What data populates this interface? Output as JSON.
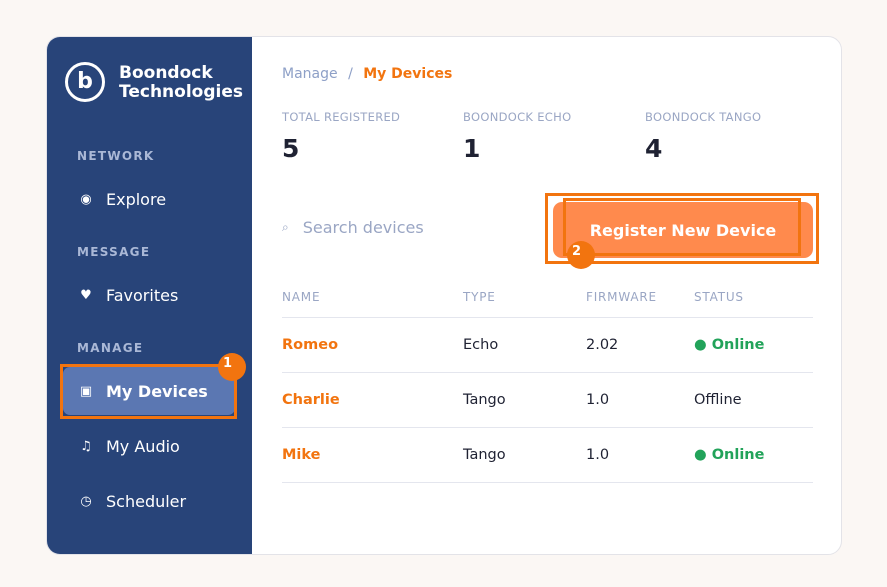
{
  "brand": {
    "logo_letter": "b",
    "name_line1": "Boondock",
    "name_line2": "Technologies"
  },
  "sidebar": {
    "sections": [
      {
        "label": "NETWORK"
      },
      {
        "label": "MESSAGE"
      },
      {
        "label": "MANAGE"
      }
    ],
    "items": [
      {
        "label": "Explore",
        "icon": "radio-icon",
        "glyph": "◉"
      },
      {
        "label": "Favorites",
        "icon": "heart-icon",
        "glyph": "♥"
      },
      {
        "label": "My Devices",
        "icon": "device-icon",
        "glyph": "▣",
        "active": true
      },
      {
        "label": "My Audio",
        "icon": "music-note-icon",
        "glyph": "♫"
      },
      {
        "label": "Scheduler",
        "icon": "clock-icon",
        "glyph": "◷"
      }
    ]
  },
  "breadcrumb": {
    "parent": "Manage",
    "separator": "/",
    "current": "My Devices"
  },
  "stats": [
    {
      "label": "TOTAL REGISTERED",
      "value": "5"
    },
    {
      "label": "BOONDOCK ECHO",
      "value": "1"
    },
    {
      "label": "BOONDOCK TANGO",
      "value": "4"
    }
  ],
  "search": {
    "placeholder": "Search devices",
    "icon_glyph": "⌕"
  },
  "register_button": {
    "label": "Register New Device"
  },
  "table": {
    "columns": [
      "NAME",
      "TYPE",
      "FIRMWARE",
      "STATUS"
    ],
    "rows": [
      {
        "name": "Romeo",
        "type": "Echo",
        "firmware": "2.02",
        "status": "● Online"
      },
      {
        "name": "Charlie",
        "type": "Tango",
        "firmware": "1.0",
        "status": "Offline"
      },
      {
        "name": "Mike",
        "type": "Tango",
        "firmware": "1.0",
        "status": "● Online"
      }
    ]
  },
  "markers": {
    "one": "1",
    "two": "2"
  },
  "colors": {
    "sidebar": "#284479",
    "accent": "#f2740f",
    "button": "#ff8a4d",
    "online": "#22a35a"
  }
}
